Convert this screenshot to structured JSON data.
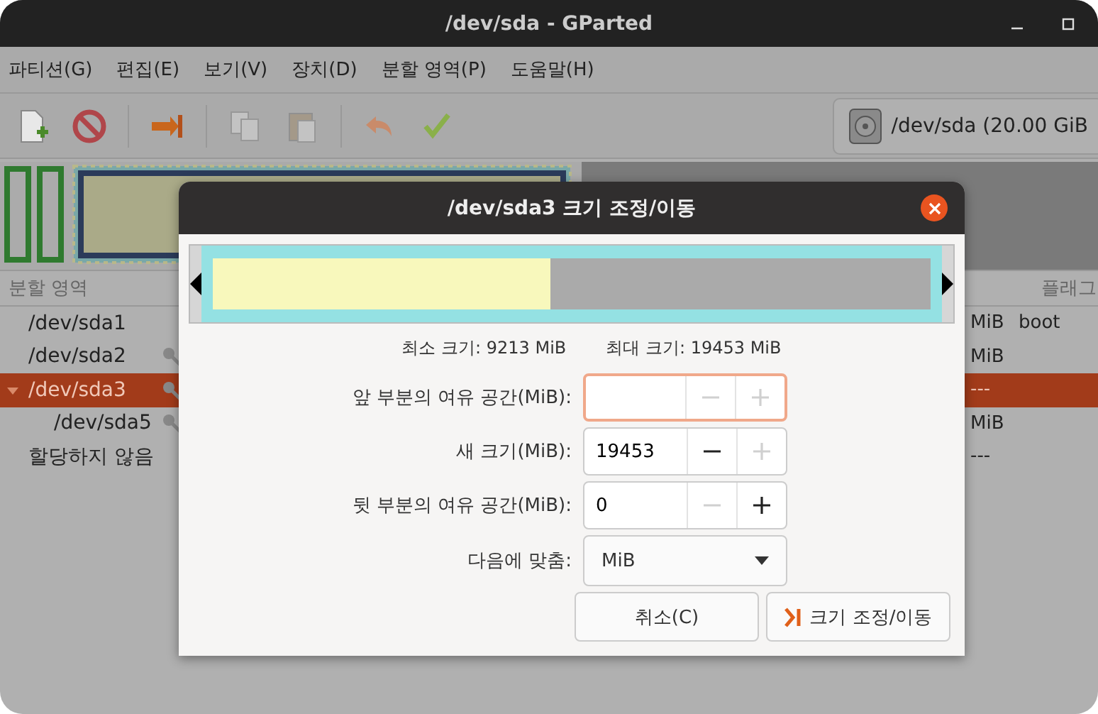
{
  "window": {
    "title": "/dev/sda - GParted"
  },
  "menu": [
    "파티션(G)",
    "편집(E)",
    "보기(V)",
    "장치(D)",
    "분할 영역(P)",
    "도움말(H)"
  ],
  "toolbar": [
    {
      "kind": "new",
      "disabled": false
    },
    {
      "kind": "delete",
      "disabled": false
    },
    {
      "kind": "resize",
      "disabled": false
    },
    {
      "kind": "copy",
      "disabled": true
    },
    {
      "kind": "paste",
      "disabled": true
    },
    {
      "kind": "undo",
      "disabled": false
    },
    {
      "kind": "apply",
      "disabled": false
    }
  ],
  "device": {
    "label": "/dev/sda (20.00 GiB"
  },
  "table": {
    "columns": [
      {
        "label": "분할 영역"
      },
      {
        "label": "플래그"
      }
    ],
    "rows": [
      {
        "partition": "/dev/sda1",
        "locked": false,
        "selected": false,
        "column_2": "MiB",
        "flags": "boot"
      },
      {
        "partition": "/dev/sda2",
        "locked": true,
        "selected": false,
        "column_2": "MiB"
      },
      {
        "partition": "/dev/sda3",
        "locked": true,
        "selected": true,
        "expanded": true,
        "column_2": "---",
        "children": [
          {
            "partition": "/dev/sda5",
            "locked": true,
            "selected": false,
            "column_2": "MiB"
          }
        ]
      },
      {
        "partition": "할당하지 않음",
        "locked": false,
        "selected": false,
        "column_2": "---"
      }
    ]
  },
  "dialog": {
    "title": "/dev/sda3 크기 조정/이동",
    "bar": {
      "level": 0.47
    },
    "min_size": "최소 크기: 9213 MiB",
    "max_size": "최대 크기: 19453 MiB",
    "fields": [
      {
        "label": "앞 부분의 여유 공간(MiB):",
        "focused": true,
        "minus_disabled": true,
        "plus_disabled": true
      },
      {
        "label": "새 크기(MiB):",
        "value": "19453",
        "focused": false,
        "minus_disabled": false,
        "plus_disabled": true
      },
      {
        "label": "뒷 부분의 여유 공간(MiB):",
        "value": "0",
        "focused": false,
        "minus_disabled": true,
        "plus_disabled": false
      }
    ],
    "align": {
      "label": "다음에 맞춤:",
      "value": "MiB"
    },
    "buttons": [
      {
        "label": "취소(C)",
        "kind": "cancel"
      },
      {
        "label": "크기 조정/이동",
        "kind": "resize"
      }
    ]
  }
}
